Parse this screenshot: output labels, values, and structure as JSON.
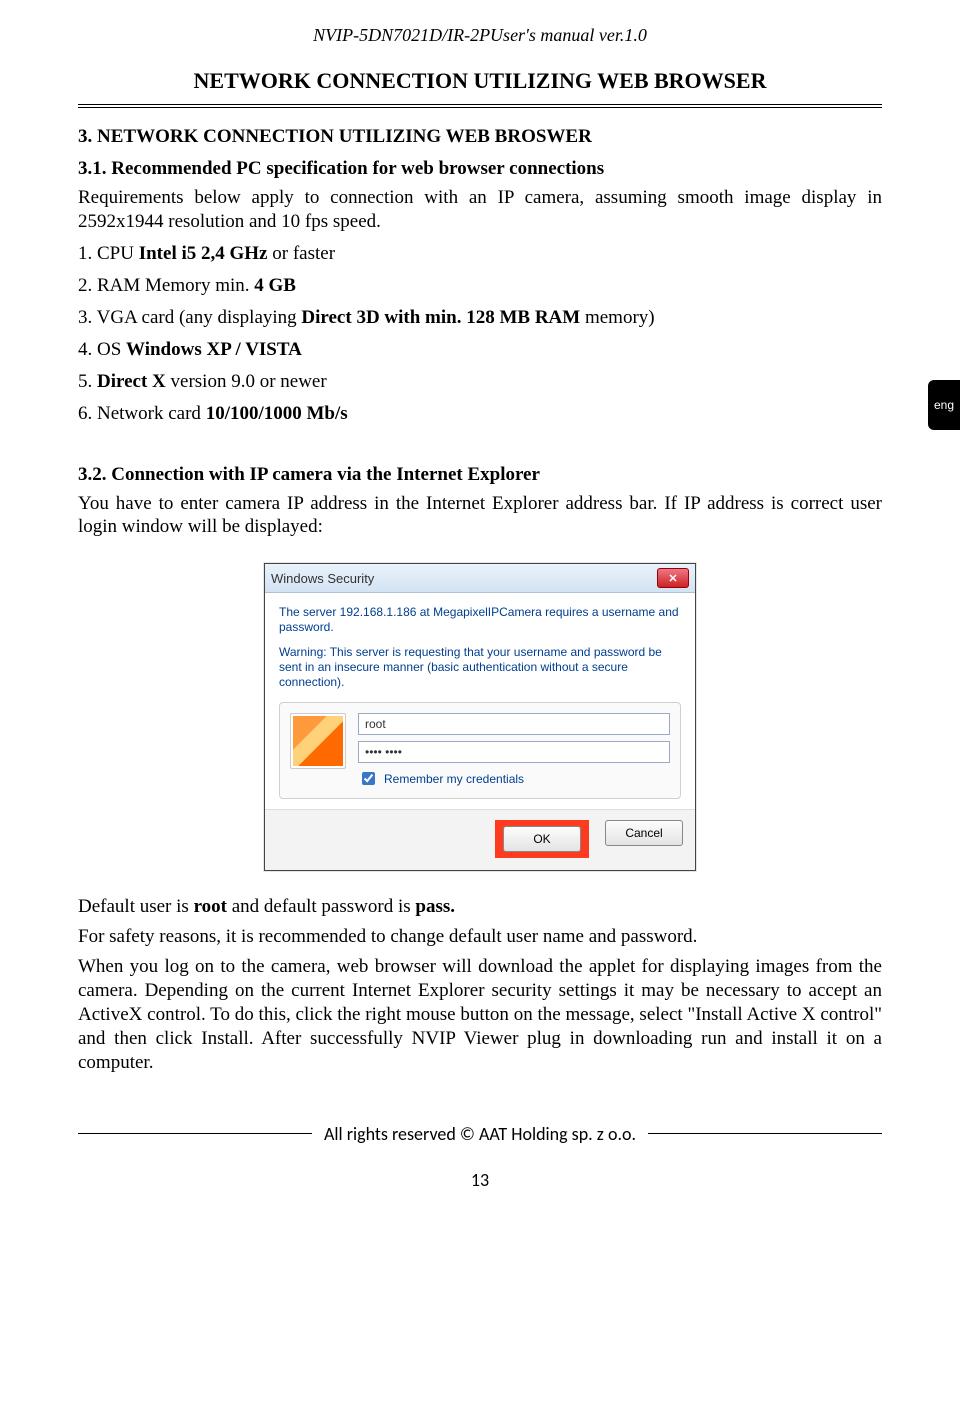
{
  "header": {
    "doc_title": "NVIP-5DN7021D/IR-2PUser's manual ver.1.0",
    "chapter_title": "NETWORK CONNECTION UTILIZING WEB BROWSER"
  },
  "lang_tab": "eng",
  "section_3": {
    "title": "3. NETWORK CONNECTION UTILIZING WEB BROSWER",
    "sub_3_1": {
      "title": "3.1. Recommended PC specification for web browser connections",
      "intro": "Requirements below apply to connection with an IP camera, assuming smooth image display in  2592x1944 resolution and 10 fps speed.",
      "items": [
        {
          "num": "1. ",
          "pre": "CPU ",
          "bold": "Intel i5 2,4 GHz",
          "post": " or faster"
        },
        {
          "num": "2. ",
          "pre": "RAM Memory min. ",
          "bold": "4 GB",
          "post": ""
        },
        {
          "num": "3. ",
          "pre": "VGA card (any displaying ",
          "bold": "Direct 3D with min. 128 MB RAM",
          "post": " memory)"
        },
        {
          "num": "4. ",
          "pre": "OS ",
          "bold": "Windows XP / VISTA",
          "post": ""
        },
        {
          "num": "5. ",
          "pre": "",
          "bold": "Direct X",
          "post": " version 9.0 or newer"
        },
        {
          "num": "6. ",
          "pre": "Network card ",
          "bold": "10/100/1000 Mb/s",
          "post": ""
        }
      ]
    },
    "sub_3_2": {
      "title": "3.2. Connection with IP camera via the Internet Explorer",
      "intro": "You have to enter camera IP address in the Internet Explorer address bar. If IP address is correct user login window will be displayed:",
      "after_dialog": [
        {
          "plain_before": "Default user is ",
          "b1": "root",
          "mid": " and default password is ",
          "b2": "pass.",
          "after": ""
        },
        {
          "plain": "For safety reasons, it is recommended to change default user name and password."
        },
        {
          "plain": "When you log on to the camera, web browser will download the applet for displaying images from the camera. Depending on the current Internet Explorer security settings it may be necessary to accept an ActiveX control. To do this, click the right mouse button on the message, select \"Install Active X control\" and then click Install. After successfully NVIP Viewer plug in downloading run and install it on a computer."
        }
      ]
    }
  },
  "dialog": {
    "title": "Windows Security",
    "close_icon": "✕",
    "msg1": "The server 192.168.1.186 at MegapixelIPCamera requires a username and password.",
    "msg2": "Warning: This server is requesting that your username and password be sent in an insecure manner (basic authentication without a secure connection).",
    "username_value": "root",
    "password_value": "•••• ••••",
    "remember_label": "Remember my credentials",
    "ok_label": "OK",
    "cancel_label": "Cancel"
  },
  "footer": {
    "rights": "All rights reserved © AAT Holding sp. z o.o.",
    "page_number": "13"
  }
}
